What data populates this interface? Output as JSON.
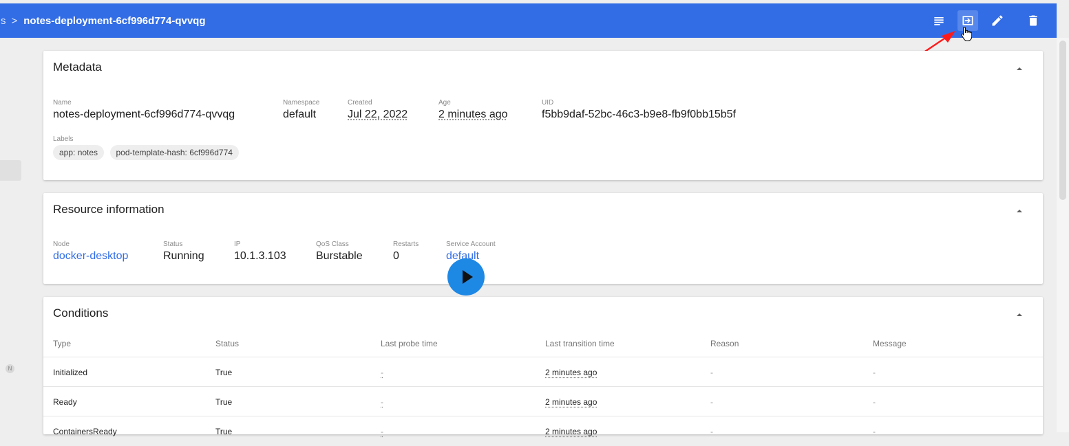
{
  "header": {
    "breadcrumb_prev": "s",
    "breadcrumb_sep": ">",
    "breadcrumb_current": "notes-deployment-6cf996d774-qvvqg",
    "background_color": "#326de6",
    "actions": [
      "logs-icon",
      "exec-icon",
      "edit-icon",
      "delete-icon"
    ]
  },
  "sidebar": {
    "badge": "N"
  },
  "metadata": {
    "title": "Metadata",
    "name_label": "Name",
    "name": "notes-deployment-6cf996d774-qvvqg",
    "namespace_label": "Namespace",
    "namespace": "default",
    "created_label": "Created",
    "created": "Jul 22, 2022",
    "age_label": "Age",
    "age": "2 minutes ago",
    "uid_label": "UID",
    "uid": "f5bb9daf-52bc-46c3-b9e8-fb9f0bb15b5f",
    "labels_label": "Labels",
    "labels": [
      "app: notes",
      "pod-template-hash: 6cf996d774"
    ]
  },
  "resource": {
    "title": "Resource information",
    "node_label": "Node",
    "node": "docker-desktop",
    "status_label": "Status",
    "status": "Running",
    "ip_label": "IP",
    "ip": "10.1.3.103",
    "qos_label": "QoS Class",
    "qos": "Burstable",
    "restarts_label": "Restarts",
    "restarts": "0",
    "sa_label": "Service Account",
    "sa": "default"
  },
  "conditions": {
    "title": "Conditions",
    "columns": [
      "Type",
      "Status",
      "Last probe time",
      "Last transition time",
      "Reason",
      "Message"
    ],
    "rows": [
      [
        "Initialized",
        "True",
        "-",
        "2 minutes ago",
        "-",
        "-"
      ],
      [
        "Ready",
        "True",
        "-",
        "2 minutes ago",
        "-",
        "-"
      ],
      [
        "ContainersReady",
        "True",
        "-",
        "2 minutes ago",
        "-",
        "-"
      ]
    ]
  }
}
